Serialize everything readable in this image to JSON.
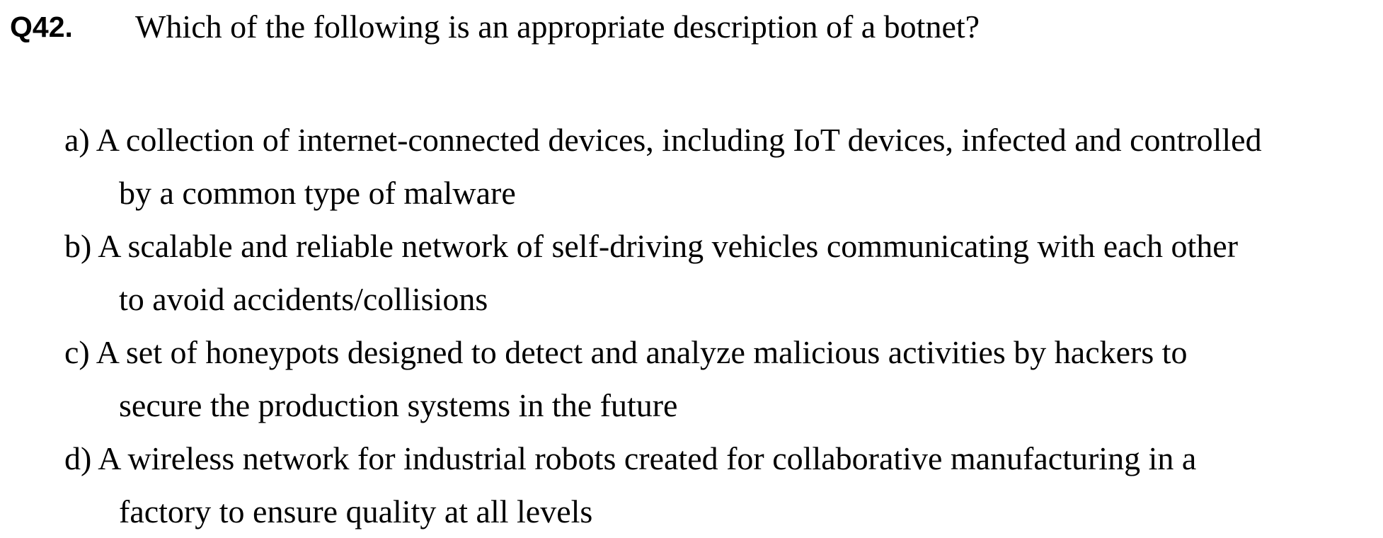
{
  "question": {
    "number": "Q42.",
    "text": "Which of the following is an appropriate description of a botnet?"
  },
  "options": [
    {
      "letter": "a)",
      "line1": "A collection of internet-connected devices, including IoT devices, infected and controlled",
      "line2": "by a common type of malware"
    },
    {
      "letter": "b)",
      "line1": "A scalable and reliable network of self-driving vehicles communicating with each other",
      "line2": "to avoid accidents/collisions"
    },
    {
      "letter": "c)",
      "line1": "A set of honeypots designed to detect and analyze malicious activities by hackers to",
      "line2": "secure the production systems in the future"
    },
    {
      "letter": "d)",
      "line1": "A wireless network for industrial robots created for collaborative manufacturing in a",
      "line2": "factory to ensure quality at all levels"
    }
  ]
}
